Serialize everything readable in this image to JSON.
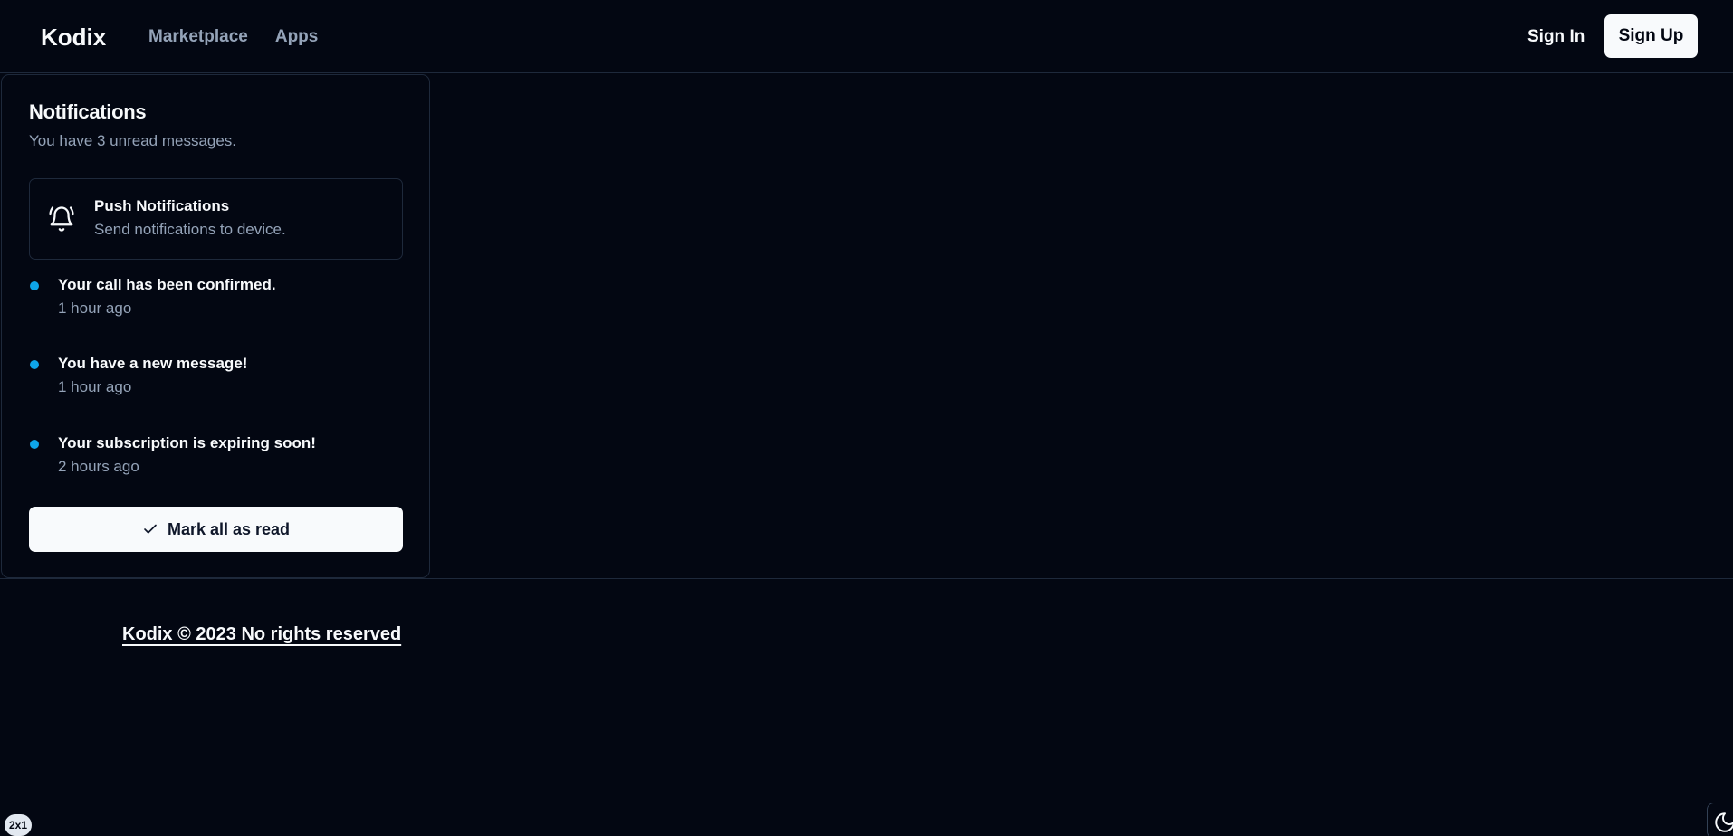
{
  "header": {
    "brand": "Kodix",
    "nav": [
      "Marketplace",
      "Apps"
    ],
    "sign_in": "Sign In",
    "sign_up": "Sign Up"
  },
  "notifications_card": {
    "title": "Notifications",
    "description": "You have 3 unread messages.",
    "push": {
      "icon": "bell-ring-icon",
      "title": "Push Notifications",
      "description": "Send notifications to device."
    },
    "items": [
      {
        "title": "Your call has been confirmed.",
        "time": "1 hour ago"
      },
      {
        "title": "You have a new message!",
        "time": "1 hour ago"
      },
      {
        "title": "Your subscription is expiring soon!",
        "time": "2 hours ago"
      }
    ],
    "mark_all": {
      "icon": "check-icon",
      "label": "Mark all as read"
    },
    "unread_dot_color": "#0ea5e9"
  },
  "footer": {
    "text": "Kodix © 2023 No rights reserved"
  },
  "widgets": {
    "badge": "2x1",
    "theme_toggle_icon": "moon-icon"
  }
}
